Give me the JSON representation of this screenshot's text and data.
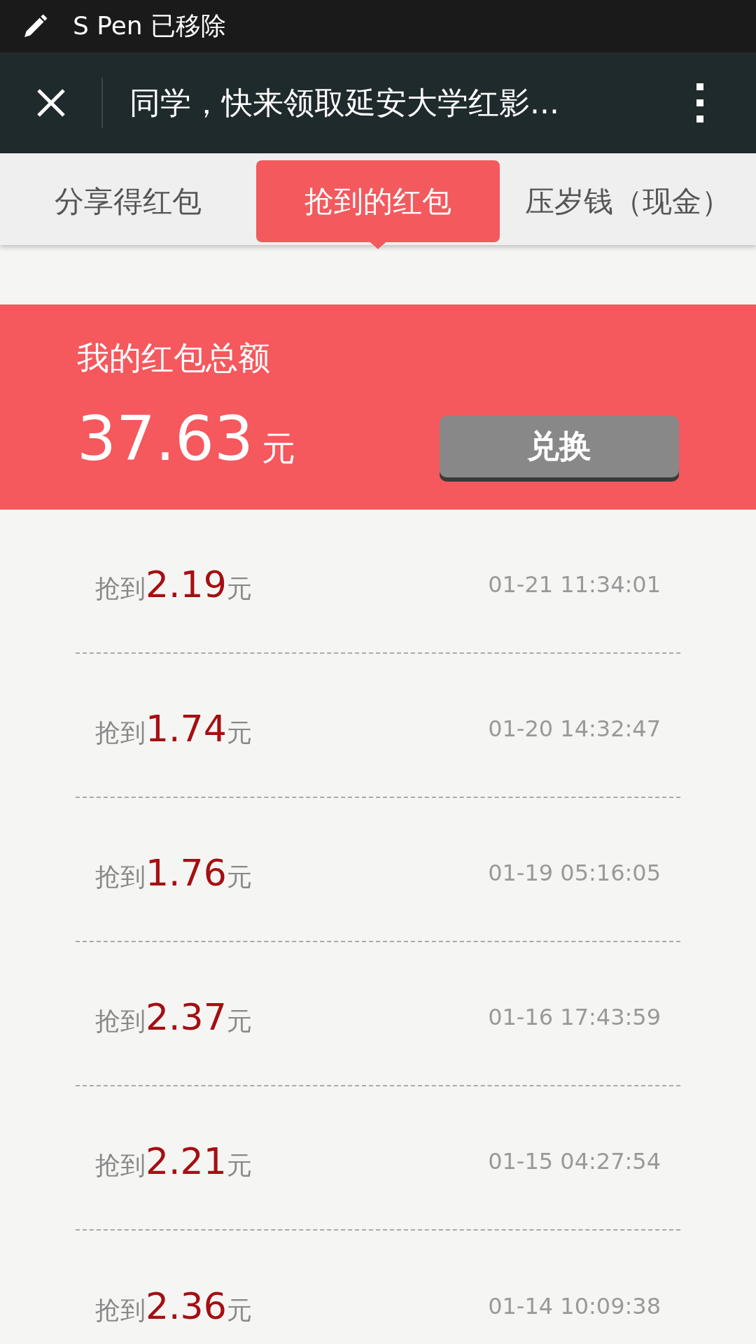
{
  "status_bar": {
    "text": "S Pen 已移除"
  },
  "title_bar": {
    "title": "同学，快来领取延安大学红影..."
  },
  "tabs": [
    {
      "label": "分享得红包",
      "selected": false
    },
    {
      "label": "抢到的红包",
      "selected": true
    },
    {
      "label": "压岁钱（现金）",
      "selected": false
    }
  ],
  "summary": {
    "label": "我的红包总额",
    "amount": "37.63",
    "unit": "元",
    "button": "兑换"
  },
  "records": [
    {
      "label": "抢到",
      "amount": "2.19",
      "unit": "元",
      "time": "01-21 11:34:01"
    },
    {
      "label": "抢到",
      "amount": "1.74",
      "unit": "元",
      "time": "01-20 14:32:47"
    },
    {
      "label": "抢到",
      "amount": "1.76",
      "unit": "元",
      "time": "01-19 05:16:05"
    },
    {
      "label": "抢到",
      "amount": "2.37",
      "unit": "元",
      "time": "01-16 17:43:59"
    },
    {
      "label": "抢到",
      "amount": "2.21",
      "unit": "元",
      "time": "01-15 04:27:54"
    },
    {
      "label": "抢到",
      "amount": "2.36",
      "unit": "元",
      "time": "01-14 10:09:38"
    }
  ]
}
